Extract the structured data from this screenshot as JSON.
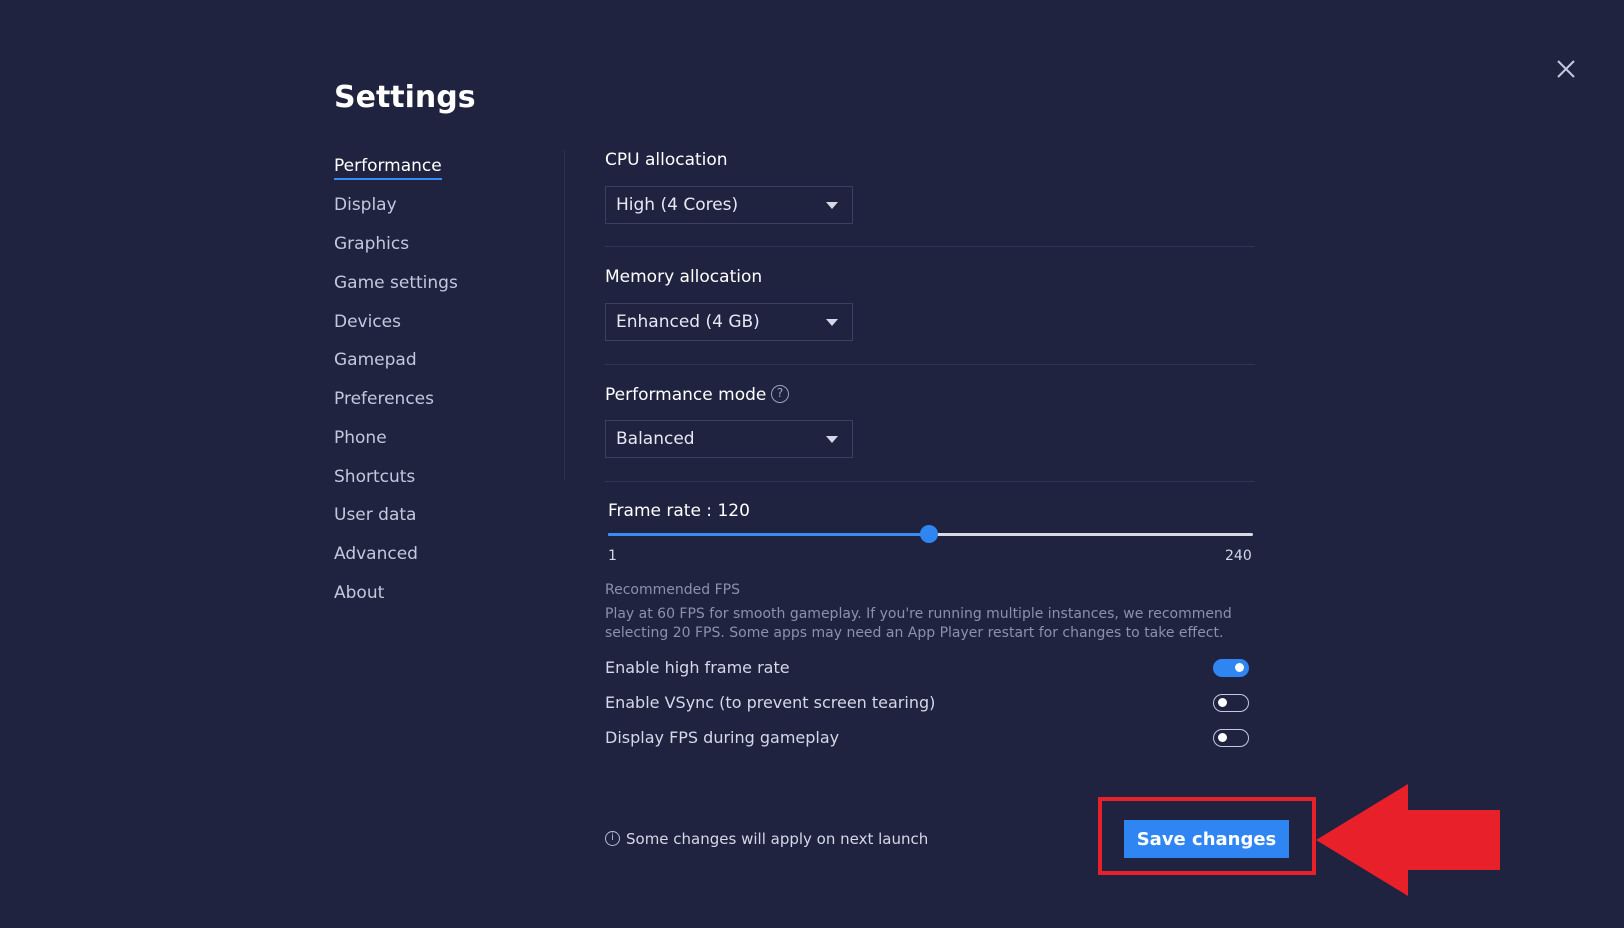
{
  "window": {
    "title": "Settings",
    "close_icon": "close-icon"
  },
  "sidebar": {
    "items": [
      {
        "label": "Performance",
        "active": true
      },
      {
        "label": "Display",
        "active": false
      },
      {
        "label": "Graphics",
        "active": false
      },
      {
        "label": "Game settings",
        "active": false
      },
      {
        "label": "Devices",
        "active": false
      },
      {
        "label": "Gamepad",
        "active": false
      },
      {
        "label": "Preferences",
        "active": false
      },
      {
        "label": "Phone",
        "active": false
      },
      {
        "label": "Shortcuts",
        "active": false
      },
      {
        "label": "User data",
        "active": false
      },
      {
        "label": "Advanced",
        "active": false
      },
      {
        "label": "About",
        "active": false
      }
    ]
  },
  "performance": {
    "cpu": {
      "label": "CPU allocation",
      "value": "High (4 Cores)"
    },
    "memory": {
      "label": "Memory allocation",
      "value": "Enhanced (4 GB)"
    },
    "mode": {
      "label": "Performance mode",
      "value": "Balanced",
      "help_icon": "question-circle-icon"
    },
    "frame_rate": {
      "label": "Frame rate : 120",
      "value": 120,
      "min": 1,
      "max": 240,
      "min_label": "1",
      "max_label": "240"
    },
    "recommended": {
      "title": "Recommended FPS",
      "text": "Play at 60 FPS for smooth gameplay. If you're running multiple instances, we recommend selecting 20 FPS. Some apps may need an App Player restart for changes to take effect."
    },
    "toggles": [
      {
        "label": "Enable high frame rate",
        "on": true
      },
      {
        "label": "Enable VSync (to prevent screen tearing)",
        "on": false
      },
      {
        "label": "Display FPS during gameplay",
        "on": false
      }
    ]
  },
  "footer": {
    "note": "Some changes will apply on next launch",
    "info_icon": "info-circle-icon",
    "save_label": "Save changes"
  },
  "annotation": {
    "highlight_color": "#e8202a"
  },
  "colors": {
    "background": "#1f2340",
    "accent": "#2f86f2",
    "text": "#ffffff",
    "muted": "#8b90ac"
  }
}
